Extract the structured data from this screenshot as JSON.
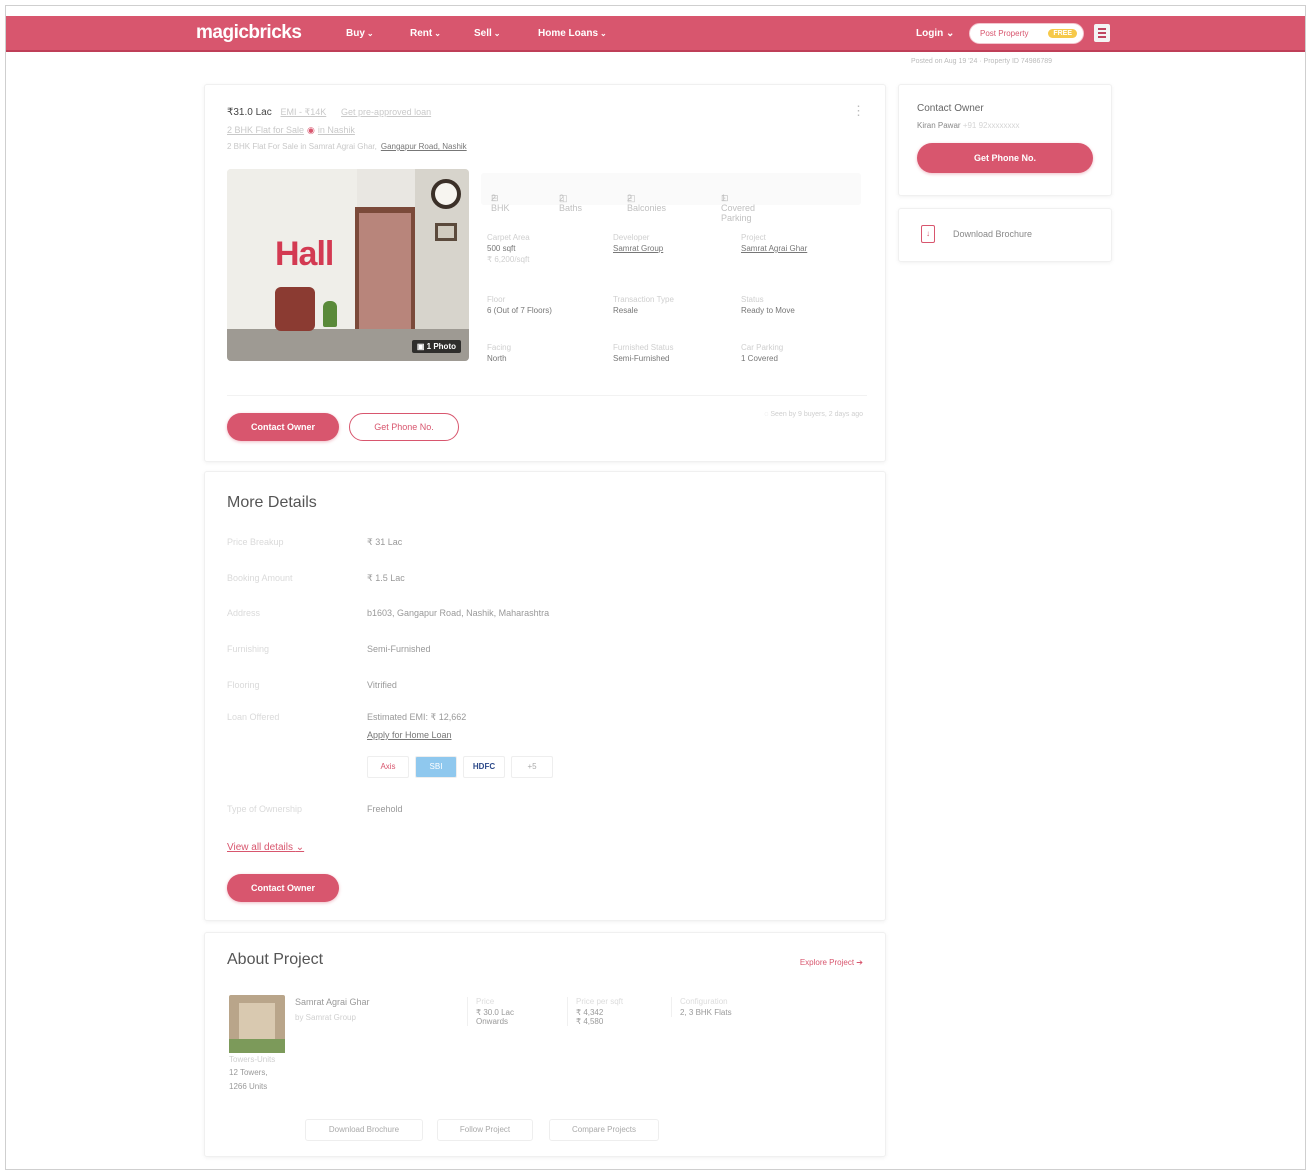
{
  "header": {
    "logo": "magicbricks",
    "nav": [
      "Buy",
      "Rent",
      "Sell",
      "Home Loans"
    ],
    "login": "Login",
    "post_property": "Post Property",
    "post_badge": "FREE"
  },
  "breadcrumb": "Posted on Aug 19 '24 · Property ID 74986789",
  "listing": {
    "price": "₹31.0 Lac",
    "emi": "EMI - ₹14K",
    "loan_link": "Get pre-approved loan",
    "title": "2 BHK Flat for Sale",
    "title_extra": "in Nashik",
    "address_prefix": "2 BHK Flat For Sale in Samrat Agrai Ghar,",
    "address_road": "Gangapur Road, Nashik",
    "amenities": [
      "2 BHK",
      "2 Baths",
      "2 Balconies",
      "1 Covered Parking"
    ],
    "photo_caption": "Hall",
    "photo_count": "1 Photo",
    "specs": {
      "carpet_label": "Carpet Area",
      "carpet_value": "500 sqft",
      "carpet_sub": "₹ 6,200/sqft",
      "developer_label": "Developer",
      "developer_value": "Samrat Group",
      "project_label": "Project",
      "project_value": "Samrat Agrai Ghar",
      "floor_label": "Floor",
      "floor_value": "6 (Out of 7 Floors)",
      "transaction_label": "Transaction Type",
      "transaction_value": "Resale",
      "status_label": "Status",
      "status_value": "Ready to Move",
      "facing_label": "Facing",
      "facing_value": "North",
      "furnished_label": "Furnished Status",
      "furnished_value": "Semi-Furnished",
      "parking_label": "Car Parking",
      "parking_value": "1 Covered"
    },
    "contact_owner": "Contact Owner",
    "get_phone": "Get Phone No.",
    "seen": "Seen by 9 buyers, 2 days ago"
  },
  "more_details": {
    "heading": "More Details",
    "rows": [
      {
        "key": "Price Breakup",
        "value": "₹ 31 Lac"
      },
      {
        "key": "Booking Amount",
        "value": "₹ 1.5 Lac"
      },
      {
        "key": "Address",
        "value": "b1603, Gangapur Road, Nashik, Maharashtra"
      },
      {
        "key": "Furnishing",
        "value": "Semi-Furnished"
      },
      {
        "key": "Flooring",
        "value": "Vitrified"
      },
      {
        "key": "Loan Offered",
        "value": "Estimated EMI: ₹ 12,662"
      }
    ],
    "apply_loan": "Apply for Home Loan",
    "banks": [
      "Axis",
      "SBI",
      "HDFC",
      "+5"
    ],
    "ownership_key": "Type of Ownership",
    "ownership_value": "Freehold",
    "view_all": "View all details",
    "contact_owner": "Contact Owner"
  },
  "about_project": {
    "heading": "About Project",
    "explore": "Explore Project",
    "name": "Samrat Agrai Ghar",
    "by": "by Samrat Group",
    "towers_label": "Towers-Units",
    "towers": "12 Towers,",
    "units": "1266 Units",
    "price_label": "Price",
    "price_value": "₹ 30.0 Lac",
    "price_sub": "Onwards",
    "sqft_label": "Price per sqft",
    "sqft_value1": "₹ 4,342",
    "sqft_value2": "₹ 4,580",
    "config_label": "Configuration",
    "config_value": "2, 3 BHK Flats",
    "buttons": [
      "Download Brochure",
      "Follow Project",
      "Compare Projects"
    ]
  },
  "sidebar": {
    "contact_title": "Contact Owner",
    "owner_name": "Kiran Pawar",
    "owner_phone": "+91 92xxxxxxxx",
    "get_phone": "Get Phone No.",
    "brochure": "Download Brochure"
  },
  "colors": {
    "brand": "#d8566e",
    "accent_badge": "#f6c94a"
  }
}
